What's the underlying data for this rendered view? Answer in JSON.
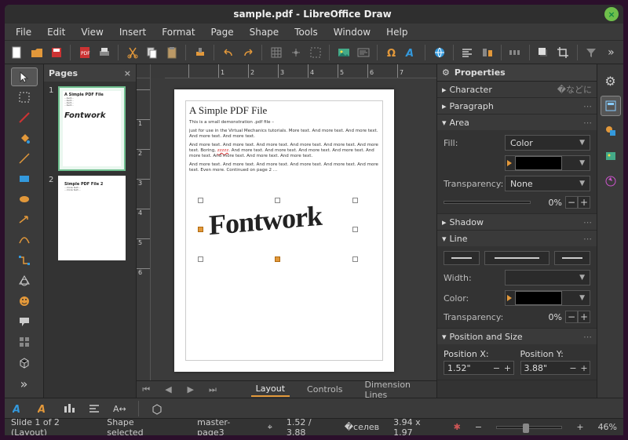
{
  "title": "sample.pdf - LibreOffice Draw",
  "menu": [
    "File",
    "Edit",
    "View",
    "Insert",
    "Format",
    "Page",
    "Shape",
    "Tools",
    "Window",
    "Help"
  ],
  "pages_panel": {
    "title": "Pages"
  },
  "ruler_h": [
    "1",
    "2",
    "3",
    "4",
    "5",
    "6",
    "7"
  ],
  "ruler_v": [
    "1",
    "2",
    "3",
    "4",
    "5",
    "6"
  ],
  "doc": {
    "heading": "A Simple PDF File",
    "p1": "This is a small demonstration .pdf file –",
    "p2": "just for use in the Virtual Mechanics tutorials. More text. And more text. And more text. And more text. And more text.",
    "p3_a": "And more text. And more text. And more text. And more text. And more text. And more text. Boring, ",
    "p3_red": "zzzzz",
    "p3_b": ". And more text. And more text. And more text. And more text. And more text. And more text. And more text. And more text.",
    "p4": "And more text. And more text. And more text. And more text. And more text. And more text. Even more. Continued on page 2 …",
    "fontwork": "Fontwork"
  },
  "thumb2_title": "Simple PDF File 2",
  "bottom_tabs": {
    "layout": "Layout",
    "controls": "Controls",
    "dimension": "Dimension Lines"
  },
  "props": {
    "title": "Properties",
    "character": "Character",
    "paragraph": "Paragraph",
    "area": "Area",
    "fill_label": "Fill:",
    "fill_value": "Color",
    "transparency_label": "Transparency:",
    "transparency_value": "None",
    "transparency_pct": "0%",
    "shadow": "Shadow",
    "line": "Line",
    "width_label": "Width:",
    "color_label": "Color:",
    "line_transp_label": "Transparency:",
    "line_transp_pct": "0%",
    "possize": "Position and Size",
    "posx_label": "Position X:",
    "posy_label": "Position Y:",
    "posx_value": "1.52\"",
    "posy_value": "3.88\""
  },
  "status": {
    "slide": "Slide 1 of 2 (Layout)",
    "sel": "Shape selected",
    "master": "master-page3",
    "pos": "1.52 / 3.88",
    "size": "3.94 x 1.97",
    "zoom": "46%"
  }
}
